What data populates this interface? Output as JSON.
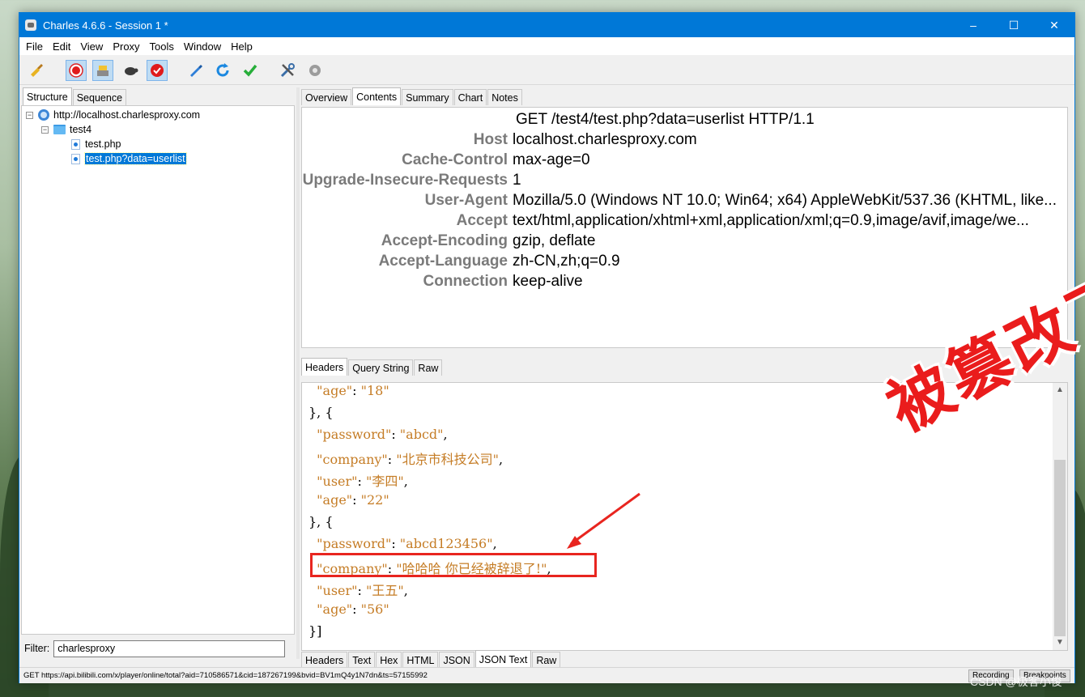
{
  "window": {
    "title": "Charles 4.6.6 - Session 1 *",
    "controls": {
      "minimize": "–",
      "maximize": "☐",
      "close": "✕"
    }
  },
  "menu": [
    {
      "label": "File"
    },
    {
      "label": "Edit"
    },
    {
      "label": "View"
    },
    {
      "label": "Proxy"
    },
    {
      "label": "Tools"
    },
    {
      "label": "Window"
    },
    {
      "label": "Help"
    }
  ],
  "toolbar": {
    "icons": [
      "broom-icon",
      "record-icon",
      "throttle-icon",
      "turtle-icon",
      "breakpoint-icon",
      "pen-icon",
      "refresh-icon",
      "check-icon",
      "tools-icon",
      "settings-icon"
    ]
  },
  "left_pane": {
    "tabs": [
      "Structure",
      "Sequence"
    ],
    "tree": {
      "host": "http://localhost.charlesproxy.com",
      "folder": "test4",
      "files": [
        "test.php",
        "test.php?data=userlist"
      ]
    },
    "filter": {
      "label": "Filter:",
      "value": "charlesproxy"
    }
  },
  "right_pane": {
    "top_tabs": [
      "Overview",
      "Contents",
      "Summary",
      "Chart",
      "Notes"
    ],
    "request_line": "GET /test4/test.php?data=userlist HTTP/1.1",
    "headers": [
      {
        "key": "Host",
        "value": "localhost.charlesproxy.com"
      },
      {
        "key": "Cache-Control",
        "value": "max-age=0"
      },
      {
        "key": "Upgrade-Insecure-Requests",
        "value": "1"
      },
      {
        "key": "User-Agent",
        "value": "Mozilla/5.0 (Windows NT 10.0; Win64; x64) AppleWebKit/537.36 (KHTML, like..."
      },
      {
        "key": "Accept",
        "value": "text/html,application/xhtml+xml,application/xml;q=0.9,image/avif,image/we..."
      },
      {
        "key": "Accept-Encoding",
        "value": "gzip, deflate"
      },
      {
        "key": "Accept-Language",
        "value": "zh-CN,zh;q=0.9"
      },
      {
        "key": "Connection",
        "value": "keep-alive"
      }
    ],
    "request_tabs": [
      "Headers",
      "Query String",
      "Raw"
    ],
    "response_tabs": [
      "Headers",
      "Text",
      "Hex",
      "HTML",
      "JSON",
      "JSON Text",
      "Raw"
    ],
    "json_lines": [
      {
        "indent": "  ",
        "key": "\"age\"",
        "value": "\"18\"",
        "end": ""
      },
      {
        "text": "}, {"
      },
      {
        "indent": "  ",
        "key": "\"password\"",
        "value": "\"abcd\"",
        "end": ","
      },
      {
        "indent": "  ",
        "key": "\"company\"",
        "value": "\"北京市科技公司\"",
        "end": ","
      },
      {
        "indent": "  ",
        "key": "\"user\"",
        "value": "\"李四\"",
        "end": ","
      },
      {
        "indent": "  ",
        "key": "\"age\"",
        "value": "\"22\"",
        "end": ""
      },
      {
        "text": "}, {"
      },
      {
        "indent": "  ",
        "key": "\"password\"",
        "value": "\"abcd123456\"",
        "end": ","
      },
      {
        "indent": "  ",
        "key": "\"company\"",
        "value": "\"哈哈哈 你已经被辞退了!\"",
        "end": ","
      },
      {
        "indent": "  ",
        "key": "\"user\"",
        "value": "\"王五\"",
        "end": ","
      },
      {
        "indent": "  ",
        "key": "\"age\"",
        "value": "\"56\"",
        "end": ""
      },
      {
        "text": "}]"
      }
    ]
  },
  "annotation": {
    "text": "被篡改了!",
    "color": "#ea1c1c"
  },
  "status_bar": {
    "text": "GET https://api.bilibili.com/x/player/online/total?aid=710586571&cid=187267199&bvid=BV1mQ4y1N7dn&ts=57155992",
    "recording": "Recording",
    "breakpoints": "Breakpoints"
  },
  "watermark": "CSDN @极客小俊"
}
